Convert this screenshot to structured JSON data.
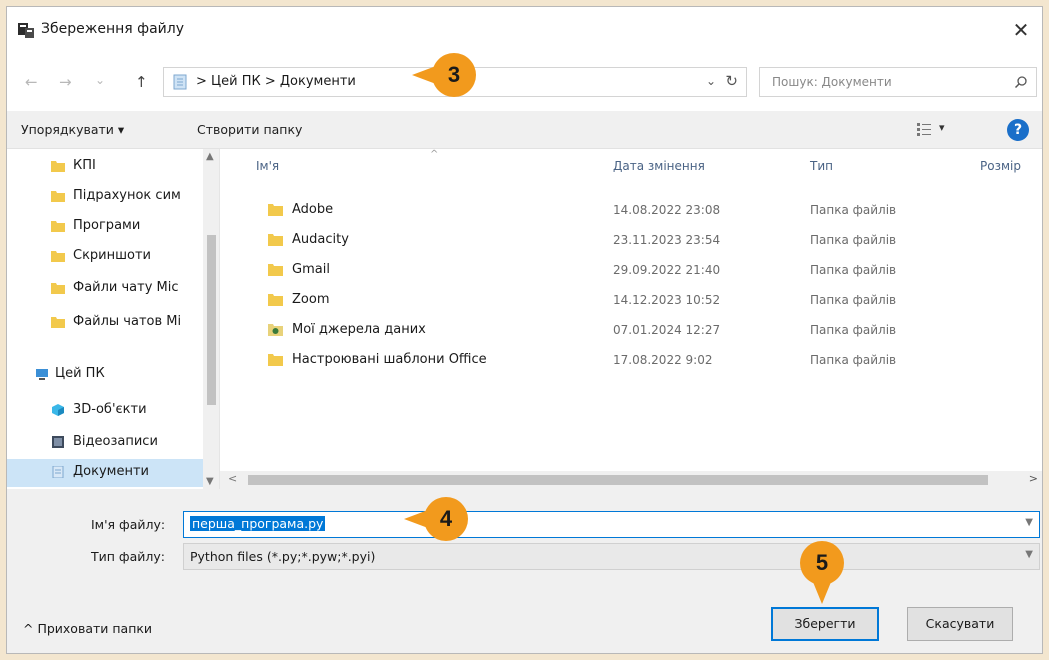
{
  "window": {
    "title": "Збереження файлу",
    "close": "✕"
  },
  "nav": {
    "back": "←",
    "forward": "→",
    "recent": "⌄",
    "up": "↑",
    "breadcrumb": "> Цей ПК > Документи",
    "refresh": "↻",
    "dropdown": "⌄",
    "search_placeholder": "Пошук: Документи"
  },
  "toolbar": {
    "organize": "Упорядкувати ▾",
    "new_folder": "Створити папку",
    "view_drop": "▾",
    "help": "?"
  },
  "sidebar": {
    "items": [
      {
        "label": "КПІ",
        "icon": "folder-icon"
      },
      {
        "label": "Підрахунок сим",
        "icon": "folder-icon"
      },
      {
        "label": "Програми",
        "icon": "folder-icon"
      },
      {
        "label": "Скриншоти",
        "icon": "folder-icon"
      },
      {
        "label": "Файли чату Міс",
        "icon": "folder-icon"
      },
      {
        "label": "Файлы чатов Mi",
        "icon": "folder-icon"
      },
      {
        "label": "Цей ПК",
        "icon": "pc-icon"
      },
      {
        "label": "3D-об'єкти",
        "icon": "cube-icon"
      },
      {
        "label": "Відеозаписи",
        "icon": "video-icon"
      },
      {
        "label": "Документи",
        "icon": "document-icon",
        "selected": true
      }
    ]
  },
  "columns": {
    "name": "Ім'я",
    "date": "Дата змінення",
    "type": "Тип",
    "size": "Розмір"
  },
  "files": [
    {
      "name": "Adobe",
      "date": "14.08.2022 23:08",
      "type": "Папка файлів",
      "icon": "folder-icon"
    },
    {
      "name": "Audacity",
      "date": "23.11.2023 23:54",
      "type": "Папка файлів",
      "icon": "folder-icon"
    },
    {
      "name": "Gmail",
      "date": "29.09.2022 21:40",
      "type": "Папка файлів",
      "icon": "folder-icon"
    },
    {
      "name": "Zoom",
      "date": "14.12.2023 10:52",
      "type": "Папка файлів",
      "icon": "folder-icon"
    },
    {
      "name": "Мої джерела даних",
      "date": "07.01.2024 12:27",
      "type": "Папка файлів",
      "icon": "data-source-icon"
    },
    {
      "name": "Настроювані шаблони Office",
      "date": "17.08.2022 9:02",
      "type": "Папка файлів",
      "icon": "folder-icon"
    }
  ],
  "form": {
    "filename_label": "Ім'я файлу:",
    "filename_value": "перша_програма.py",
    "filetype_label": "Тип файлу:",
    "filetype_value": "Python files (*.py;*.pyw;*.pyi)"
  },
  "footer": {
    "hide_folders": "^ Приховати папки",
    "save": "Зберегти",
    "cancel": "Скасувати"
  },
  "badges": [
    "3",
    "4",
    "5"
  ],
  "colors": {
    "accent": "#0078d7",
    "badge": "#f29a1d",
    "folder": "#f2c94c",
    "selection": "#cce4f7"
  }
}
